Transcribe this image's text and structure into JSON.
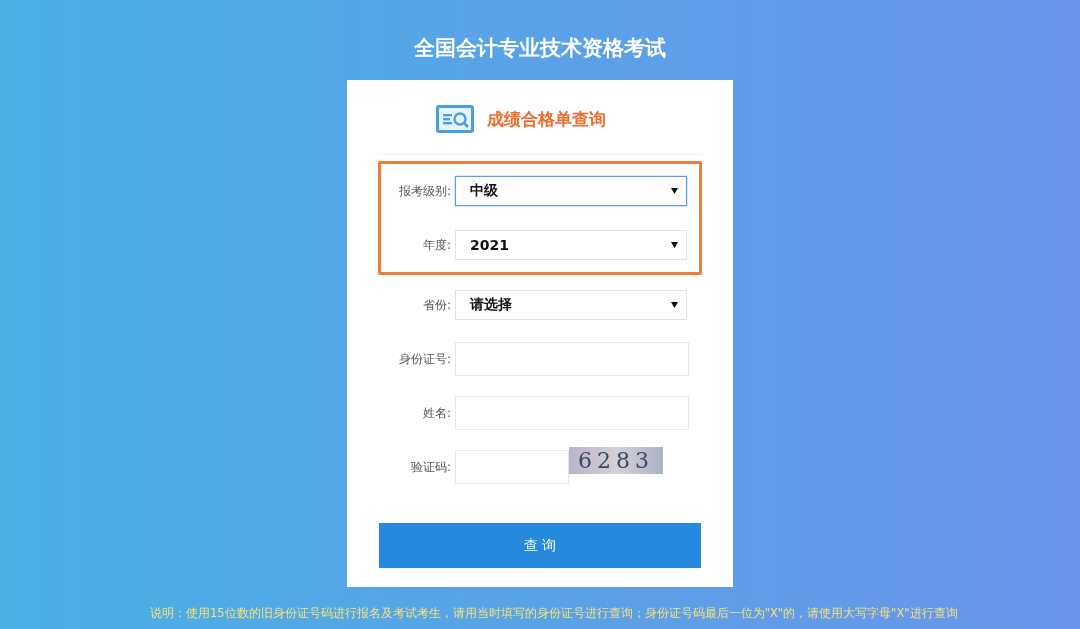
{
  "title": "全国会计专业技术资格考试",
  "card": {
    "heading": "成绩合格单查询",
    "fields": [
      {
        "kind": "select",
        "label": "报考级别:",
        "value": "中级",
        "focused": true,
        "highlighted": true
      },
      {
        "kind": "select",
        "label": "年度:",
        "value": "2021",
        "focused": false,
        "highlighted": true
      },
      {
        "kind": "select",
        "label": "省份:",
        "value": "请选择",
        "focused": false
      },
      {
        "kind": "text",
        "label": "身份证号:",
        "focused": false
      },
      {
        "kind": "text",
        "label": "姓名:",
        "focused": false
      },
      {
        "kind": "captcha",
        "label": "验证码:",
        "captcha": "6283",
        "focused": false
      }
    ],
    "submit": "查 询"
  },
  "note": "说明：使用15位数的旧身份证号码进行报名及考试考生，请用当时填写的身份证号进行查询；身份证号码最后一位为\"X\"的，请使用大写字母\"X\"进行查询"
}
